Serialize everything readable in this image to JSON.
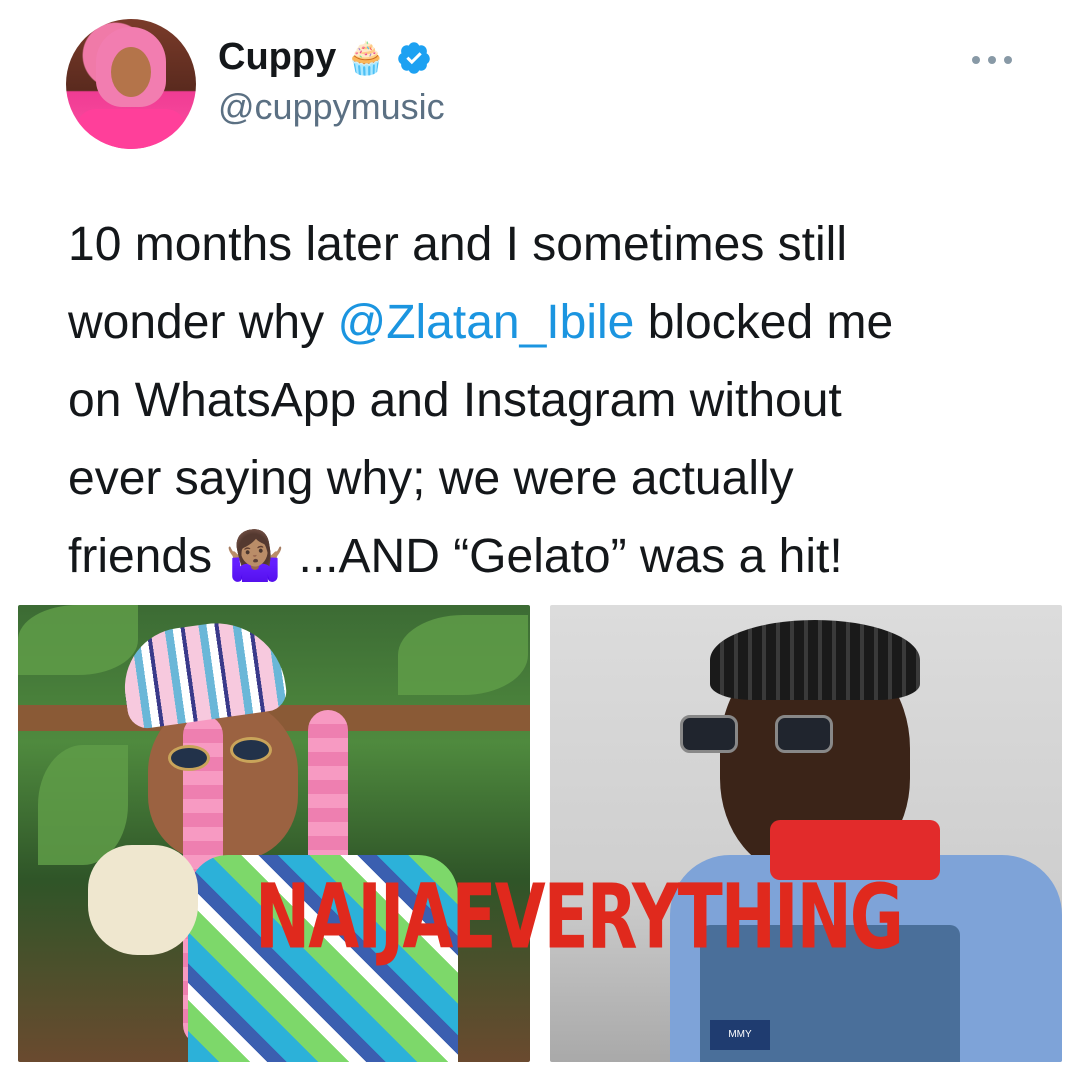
{
  "author": {
    "display_name": "Cuppy",
    "name_emoji": "🧁",
    "verified": true,
    "handle": "@cuppymusic"
  },
  "menu": {
    "icon": "more-horizontal-icon"
  },
  "tweet": {
    "text_part1": "10 months later and I sometimes still\nwonder why ",
    "mention": "@Zlatan_Ibile",
    "text_part2": " blocked me\non WhatsApp and Instagram without\never saying why; we were actually\nfriends 🤷🏽‍♀️ ...AND “Gelato” was a hit!"
  },
  "media": {
    "left_photo": "woman-with-coconut-photo",
    "right_photo": "man-with-sunglasses-photo",
    "clothing_tag": "MMY"
  },
  "watermark": "NAIJAEVERYTHING",
  "colors": {
    "link": "#1b95e0",
    "verified": "#1da1f2",
    "secondary_text": "#5b7083",
    "watermark": "#e0291d"
  }
}
